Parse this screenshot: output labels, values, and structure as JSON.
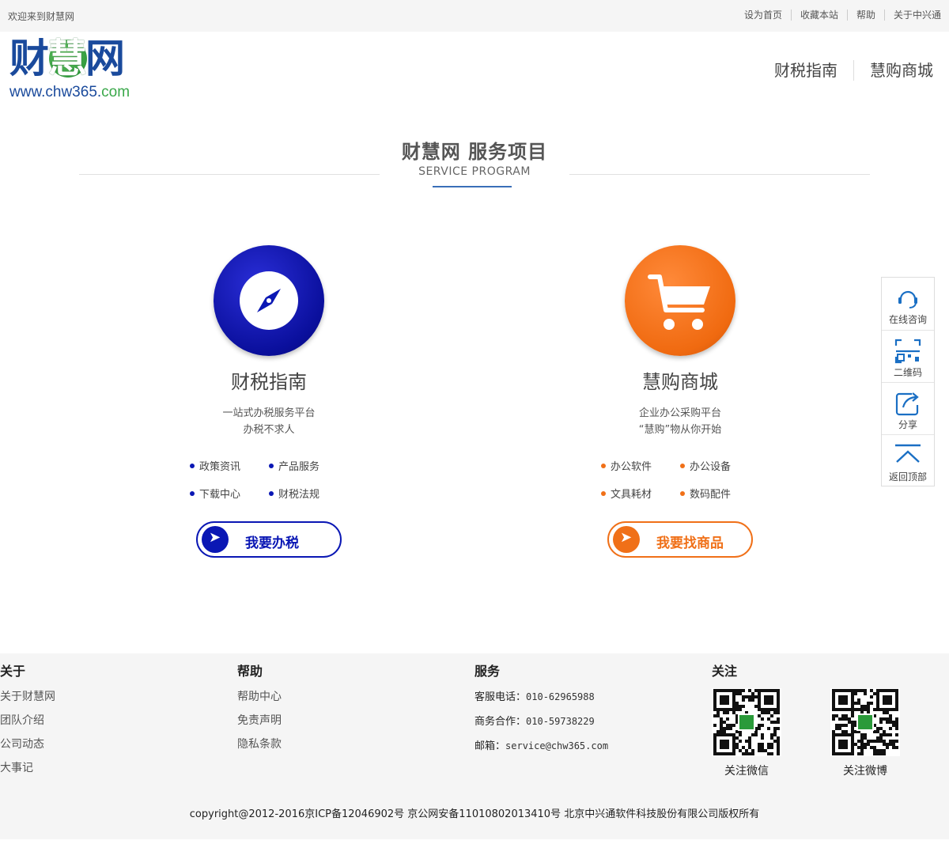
{
  "topbar": {
    "welcome": "欢迎来到财慧网",
    "links": [
      "设为首页",
      "收藏本站",
      "帮助",
      "关于中兴通"
    ]
  },
  "logo": {
    "char1": "财",
    "char2": "慧",
    "char3": "网",
    "url_main": "www.chw365.",
    "url_tld": "com"
  },
  "nav": [
    "财税指南",
    "慧购商城"
  ],
  "section": {
    "title": "财慧网  服务项目",
    "subtitle": "SERVICE PROGRAM"
  },
  "services": {
    "tax": {
      "title": "财税指南",
      "desc1": "一站式办税服务平台",
      "desc2": "办税不求人",
      "features": [
        "政策资讯",
        "产品服务",
        "下载中心",
        "财税法规"
      ],
      "cta": "我要办税",
      "color": "#0a17b4",
      "icon": "compass-icon"
    },
    "shop": {
      "title": "慧购商城",
      "desc1": "企业办公采购平台",
      "desc2": "“慧购”物从你开始",
      "features": [
        "办公软件",
        "办公设备",
        "文具耗材",
        "数码配件"
      ],
      "cta": "我要找商品",
      "color": "#f07018",
      "icon": "cart-icon"
    }
  },
  "tools": [
    "在线咨询",
    "二维码",
    "分享",
    "返回顶部"
  ],
  "footer": {
    "about": {
      "title": "关于",
      "links": [
        "关于财慧网",
        "团队介绍",
        "公司动态",
        "大事记"
      ]
    },
    "help": {
      "title": "帮助",
      "links": [
        "帮助中心",
        "免责声明",
        "隐私条款"
      ]
    },
    "service": {
      "title": "服务",
      "phone_label": "客服电话：",
      "phone": "010-62965988",
      "biz_label": "商务合作：",
      "biz": "010-59738229",
      "mail_label": "邮箱：",
      "mail": "service@chw365.com"
    },
    "follow": {
      "title": "关注",
      "wechat": "关注微信",
      "weibo": "关注微博"
    },
    "copyright": "copyright@2012-2016京ICP备12046902号 京公网安备11010802013410号 北京中兴通软件科技股份有限公司版权所有"
  }
}
